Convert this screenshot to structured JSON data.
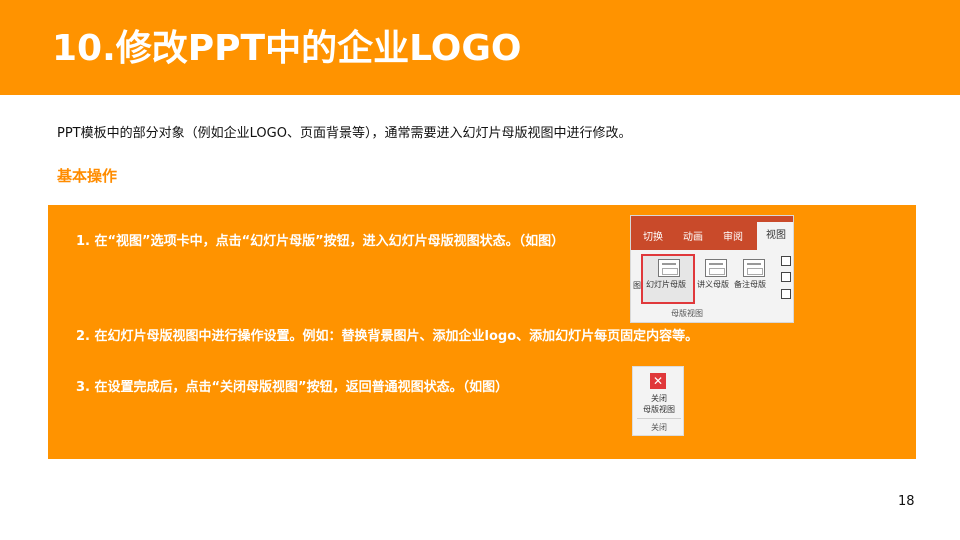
{
  "title": "10.修改PPT中的企业LOGO",
  "intro": "PPT模板中的部分对象（例如企业LOGO、页面背景等），通常需要进入幻灯片母版视图中进行修改。",
  "section_heading": "基本操作",
  "steps": [
    "1. 在“视图”选项卡中，点击“幻灯片母版”按钮，进入幻灯片母版视图状态。（如图）",
    "2. 在幻灯片母版视图中进行操作设置。例如：替换背景图片、添加企业logo、添加幻灯片每页固定内容等。",
    "3. 在设置完成后，点击“关闭母版视图”按钮，返回普通视图状态。（如图）"
  ],
  "ribbon": {
    "tabs": [
      "切换",
      "动画",
      "审阅",
      "视图"
    ],
    "buttons": [
      "幻灯片母版",
      "讲义母版",
      "备注母版"
    ],
    "group_label": "母版视图"
  },
  "close_button": {
    "line1": "关闭",
    "line2": "母版视图",
    "group_label": "关闭"
  },
  "page_number": "18",
  "colors": {
    "accent": "#FF9300",
    "ribbon_tab": "#C94A2A",
    "highlight": "#E0383B"
  }
}
